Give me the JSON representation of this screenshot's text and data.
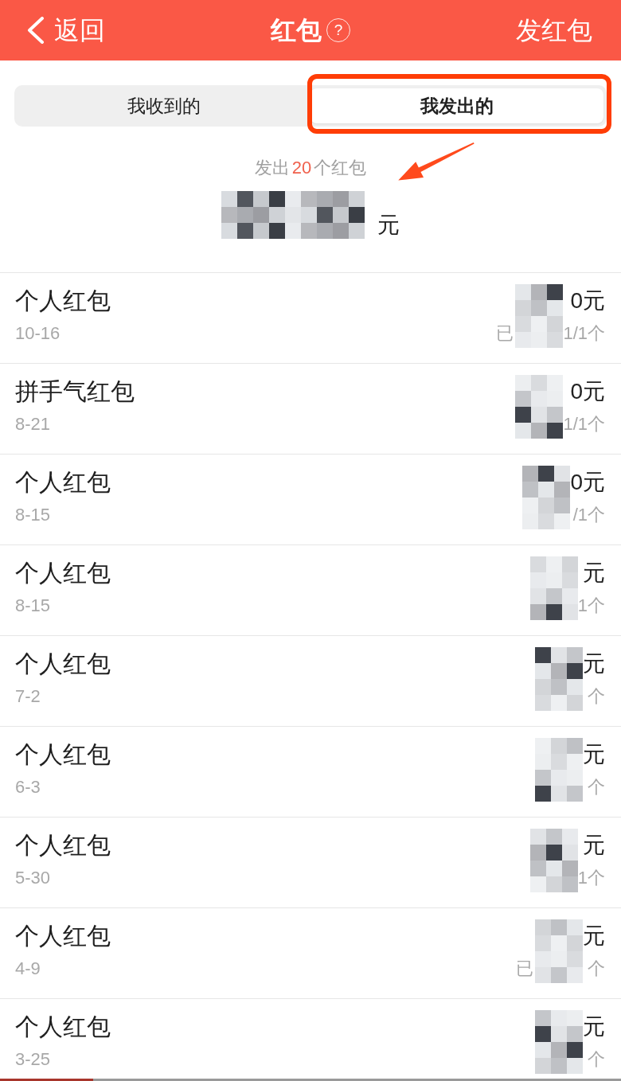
{
  "header": {
    "back": "返回",
    "title": "红包",
    "help": "?",
    "action": "发红包"
  },
  "tabs": [
    {
      "label": "我收到的",
      "selected": false,
      "highlighted": false
    },
    {
      "label": "我发出的",
      "selected": true,
      "highlighted": true
    }
  ],
  "summary": {
    "prefix": "发出",
    "count": "20",
    "suffix": "个红包",
    "redacted": true,
    "unit": "元",
    "pointer_arrow": true
  },
  "packets": [
    {
      "title": "个人红包",
      "date": "10-16",
      "redacted": true,
      "amount": "0元",
      "status": "已",
      "count": "1/1个"
    },
    {
      "title": "拼手气红包",
      "date": "8-21",
      "redacted": true,
      "amount": "0元",
      "count": "1/1个"
    },
    {
      "title": "个人红包",
      "date": "8-15",
      "redacted": true,
      "amount": "0元",
      "count": "/1个"
    },
    {
      "title": "个人红包",
      "date": "8-15",
      "redacted": true,
      "amount": "元",
      "count": "1个"
    },
    {
      "title": "个人红包",
      "date": "7-2",
      "redacted": true,
      "amount": "元",
      "count": "个"
    },
    {
      "title": "个人红包",
      "date": "6-3",
      "redacted": true,
      "amount": "元",
      "count": "个"
    },
    {
      "title": "个人红包",
      "date": "5-30",
      "redacted": true,
      "amount": "元",
      "count": "1个"
    },
    {
      "title": "个人红包",
      "date": "4-9",
      "redacted": true,
      "amount": "元",
      "status": "已",
      "count": "个"
    },
    {
      "title": "个人红包",
      "date": "3-25",
      "redacted": true,
      "amount": "元",
      "count": "个"
    }
  ],
  "bottom_bar": {
    "level": 0.15
  }
}
